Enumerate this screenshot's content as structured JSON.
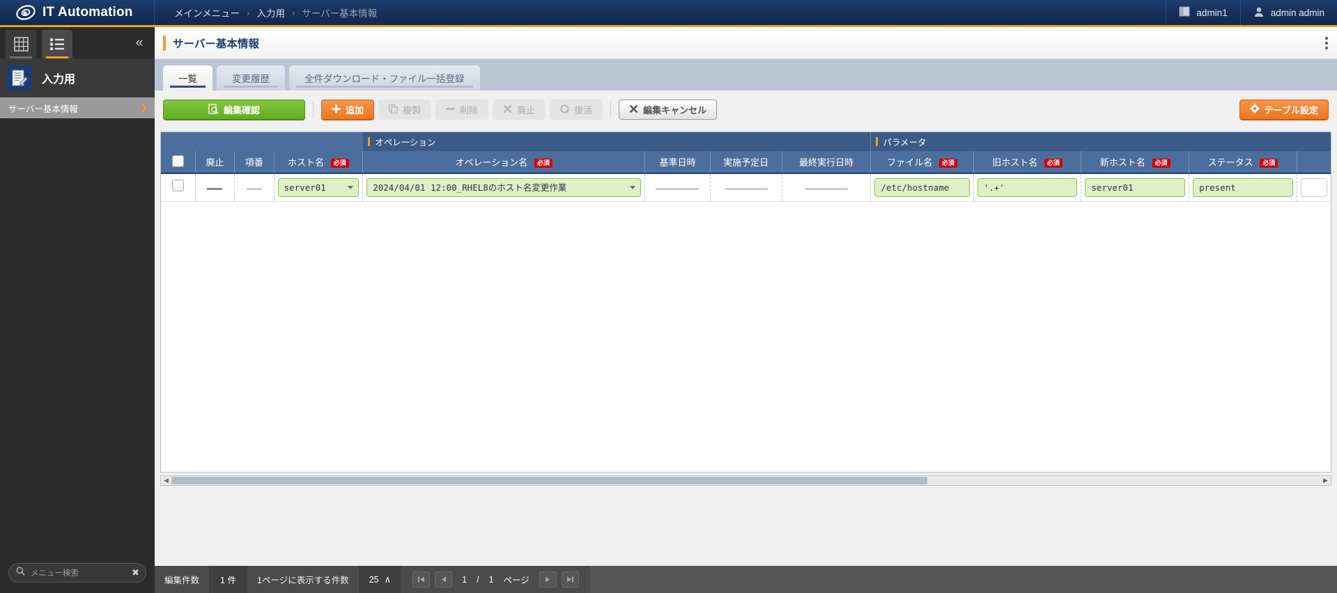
{
  "topbar": {
    "brand": "IT Automation",
    "breadcrumb": [
      "メインメニュー",
      "入力用",
      "サーバー基本情報"
    ],
    "separator": "›",
    "workspace": "admin1",
    "user": "admin admin"
  },
  "sidebar": {
    "tabs": [
      {
        "name": "grid-view-tab",
        "icon": "grid-icon",
        "selected": false
      },
      {
        "name": "list-view-tab",
        "icon": "list-icon",
        "selected": true
      }
    ],
    "collapse_icon": "«",
    "menu_head": "入力用",
    "items": [
      {
        "label": "サーバー基本情報",
        "selected": true,
        "arrow": "❯"
      }
    ],
    "search_placeholder": "メニュー検索",
    "search_value": "",
    "search_icon": "search-icon",
    "clear_icon": "✖"
  },
  "page": {
    "title": "サーバー基本情報",
    "tabs": [
      {
        "label": "一覧",
        "selected": true
      },
      {
        "label": "変更履歴",
        "selected": false
      },
      {
        "label": "全件ダウンロード・ファイル一括登録",
        "selected": false
      }
    ]
  },
  "toolbar": {
    "confirm_edit": "編集確認",
    "add": "追加",
    "duplicate": "複製",
    "delete": "削除",
    "discard": "廃止",
    "restore": "復活",
    "cancel_edit": "編集キャンセル",
    "table_settings": "テーブル設定",
    "accent_green": "#62ad21",
    "accent_orange": "#ef7620"
  },
  "table": {
    "groups": [
      {
        "label": "",
        "span": 4
      },
      {
        "label": "オペレーション",
        "span": 4
      },
      {
        "label": "パラメータ",
        "span": 4
      }
    ],
    "headers": [
      {
        "label": "",
        "required": false,
        "type": "checkbox"
      },
      {
        "label": "廃止",
        "required": false
      },
      {
        "label": "項番",
        "required": false
      },
      {
        "label": "ホスト名",
        "required": true
      },
      {
        "label": "オペレーション名",
        "required": true
      },
      {
        "label": "基準日時",
        "required": false
      },
      {
        "label": "実施予定日",
        "required": false
      },
      {
        "label": "最終実行日時",
        "required": false
      },
      {
        "label": "ファイル名",
        "required": true
      },
      {
        "label": "旧ホスト名",
        "required": true
      },
      {
        "label": "新ホスト名",
        "required": true
      },
      {
        "label": "ステータス",
        "required": true
      }
    ],
    "required_badge": "必須",
    "rows": [
      {
        "checkbox": false,
        "discard": "—",
        "seq": "—",
        "host_name": "server01",
        "operation_name": "2024/04/01 12:00_RHEL8のホスト名変更作業",
        "base_datetime": "",
        "scheduled_date": "",
        "last_exec_datetime": "",
        "file_name": "/etc/hostname",
        "old_host_name": "'.+'",
        "new_host_name": "server01",
        "status": "present"
      }
    ]
  },
  "footer": {
    "edit_count_label": "編集件数",
    "edit_count_value": "1 件",
    "per_page_label": "1ページに表示する件数",
    "per_page_value": "25",
    "per_page_caret": "∧",
    "page_current": "1",
    "page_separator": "/",
    "page_total": "1",
    "page_unit": "ページ",
    "first_icon": "⏮",
    "prev_icon": "◀",
    "next_icon": "▶",
    "last_icon": "⏭"
  }
}
